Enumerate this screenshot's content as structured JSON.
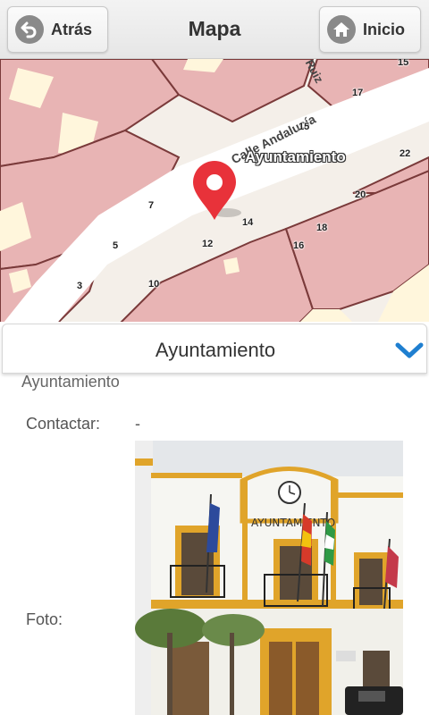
{
  "header": {
    "back_label": "Atrás",
    "title": "Mapa",
    "home_label": "Inicio"
  },
  "map": {
    "poi_label": "Ayuntamiento",
    "street_main": "Calle Andalucía",
    "street_top": "Ruiz",
    "house_numbers": [
      "15",
      "17",
      "15",
      "22",
      "7",
      "14",
      "20",
      "18",
      "5",
      "12",
      "16",
      "3",
      "10"
    ],
    "marker_color": "#e8323a"
  },
  "panel": {
    "title": "Ayuntamiento",
    "subtitle": "Ayuntamiento",
    "contact_label": "Contactar:",
    "contact_value": "-",
    "photo_label": "Foto:",
    "photo_sign": "AYUNTAMIENTO",
    "accent_color": "#1f7fd0"
  }
}
